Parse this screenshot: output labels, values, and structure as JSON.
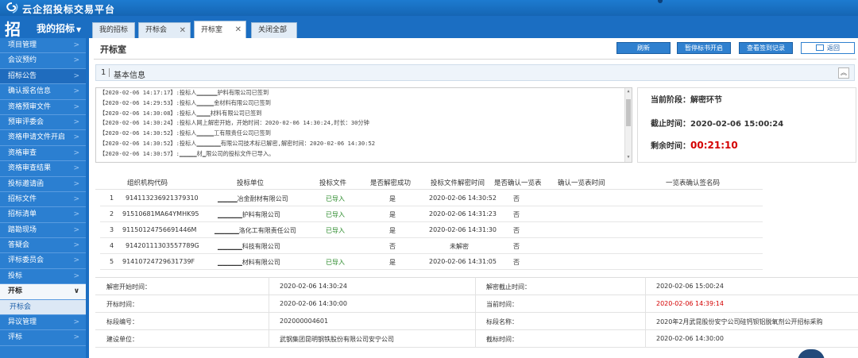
{
  "app": {
    "title": "云企招投标交易平台"
  },
  "nav": {
    "brand_glyph": "招",
    "menu_label": "我的招标",
    "tabs": [
      {
        "label": "我的招标",
        "closable": false,
        "active": false
      },
      {
        "label": "开标会",
        "closable": true,
        "active": false
      },
      {
        "label": "开标室",
        "closable": true,
        "active": true
      },
      {
        "label": "关闭全部",
        "closable": false,
        "active": false
      }
    ]
  },
  "sidebar": {
    "items": [
      {
        "label": "项目管理"
      },
      {
        "label": "会议预约"
      },
      {
        "label": "招标公告"
      },
      {
        "label": "确认报名信息"
      },
      {
        "label": "资格预审文件"
      },
      {
        "label": "预审评委会"
      },
      {
        "label": "资格申请文件开启"
      },
      {
        "label": "资格审查"
      },
      {
        "label": "资格审查结果"
      },
      {
        "label": "投标邀请函"
      },
      {
        "label": "招标文件"
      },
      {
        "label": "招标清单"
      },
      {
        "label": "踏勘现场"
      },
      {
        "label": "答疑会"
      },
      {
        "label": "评标委员会"
      },
      {
        "label": "投标"
      },
      {
        "label": "开标"
      },
      {
        "label": "开标会"
      },
      {
        "label": "异议管理"
      },
      {
        "label": "评标"
      }
    ]
  },
  "page": {
    "title": "开标室",
    "buttons": {
      "refresh": "刷新",
      "pause": "暂停标书开启",
      "sign_record": "查看签到记录",
      "back": "返回"
    }
  },
  "section": {
    "number": "1",
    "label": "基本信息"
  },
  "log": [
    "【2020-02-06 14:17:17】:投标人▁▁▁▁▁▁护料有限公司已签到",
    "【2020-02-06 14:29:53】:投标人▁▁▁▁▁金材料有限公司已签到",
    "【2020-02-06 14:30:08】:投标人▁▁▁▁材料有限公司已签到",
    "【2020-02-06 14:30:24】:投标人网上解密开始，开始时间：2020-02-06 14:30:24,时长：30分钟",
    "【2020-02-06 14:30:52】:投标人▁▁▁▁▁工有限责任公司已签到",
    "【2020-02-06 14:30:52】:投标人▁▁▁▁▁▁▁有限公司技术标已解密,解密时间：2020-02-06 14:30:52",
    "【2020-02-06 14:30:57】:▁▁▁▁▁材▁限公司的投标文件已导入。"
  ],
  "status": {
    "phase_label": "当前阶段：",
    "phase_value": "解密环节",
    "deadline_label": "截止时间：",
    "deadline_value": "2020-02-06 15:00:24",
    "remain_label": "剩余时间：",
    "remain_value": "00:21:10"
  },
  "bid_table": {
    "headers": [
      "组织机构代码",
      "投标单位",
      "投标文件",
      "是否解密成功",
      "投标文件解密时间",
      "是否确认一览表",
      "确认一览表时间",
      "一览表确认签名码"
    ],
    "rows": [
      {
        "no": "1",
        "code": "91411323692137931​0",
        "unit": "▁▁▁▁冶金耐材有限公司",
        "file": "已导入",
        "decrypted": "是",
        "decrypt_time": "2020-02-06 14:30:52",
        "confirmed": "否"
      },
      {
        "no": "2",
        "code": "91510681MA64YMHK95",
        "unit": "▁▁▁▁▁护料有限公司",
        "file": "已导入",
        "decrypted": "是",
        "decrypt_time": "2020-02-06 14:31:23",
        "confirmed": "否"
      },
      {
        "no": "3",
        "code": "9115012475669​1446M",
        "unit": "▁▁▁▁▁洛化工有限责任公司",
        "file": "已导入",
        "decrypted": "是",
        "decrypt_time": "2020-02-06 14:31:30",
        "confirmed": "否"
      },
      {
        "no": "4",
        "code": "9142011130355778​9G",
        "unit": "▁▁▁▁▁科技有限公司",
        "file": "",
        "decrypted": "否",
        "decrypt_time": "未解密",
        "confirmed": "否"
      },
      {
        "no": "5",
        "code": "91410724729631739F",
        "unit": "▁▁▁▁▁材料有限公司",
        "file": "已导入",
        "decrypted": "是",
        "decrypt_time": "2020-02-06 14:31:05",
        "confirmed": "否"
      }
    ]
  },
  "info": {
    "rows": [
      {
        "l1": "解密开始时间：",
        "v1": "2020-02-06 14:30:24",
        "l2": "解密截止时间：",
        "v2": "2020-02-06 15:00:24",
        "v2_red": false
      },
      {
        "l1": "开标时间：",
        "v1": "2020-02-06 14:30:00",
        "l2": "当前时间：",
        "v2": "2020-02-06 14:39:14",
        "v2_red": true
      },
      {
        "l1": "标段编号：",
        "v1": "202000004601",
        "l2": "标段名称：",
        "v2": "2020年2月武昆股份安宁公司硅钙钡铝脱氧剂公开招标采购",
        "v2_red": false
      },
      {
        "l1": "建设单位：",
        "v1": "武钢集团昆明钢铁股份有限公司安宁公司",
        "l2": "截标时间：",
        "v2": "2020-02-06 14:30:00",
        "v2_red": false
      }
    ]
  },
  "colors": {
    "brand_blue": "#1b6ec2",
    "sidebar_blue": "#2b7fd1",
    "alert_red": "#d40000",
    "imported_green": "#2a8a2a"
  },
  "icons": {
    "logo": "swirl-logo-icon",
    "brand": "zhao-brand-icon",
    "collapse": "double-chevron-up-icon",
    "back": "back-arrow-icon",
    "chat": "chat-bubble-icon"
  }
}
